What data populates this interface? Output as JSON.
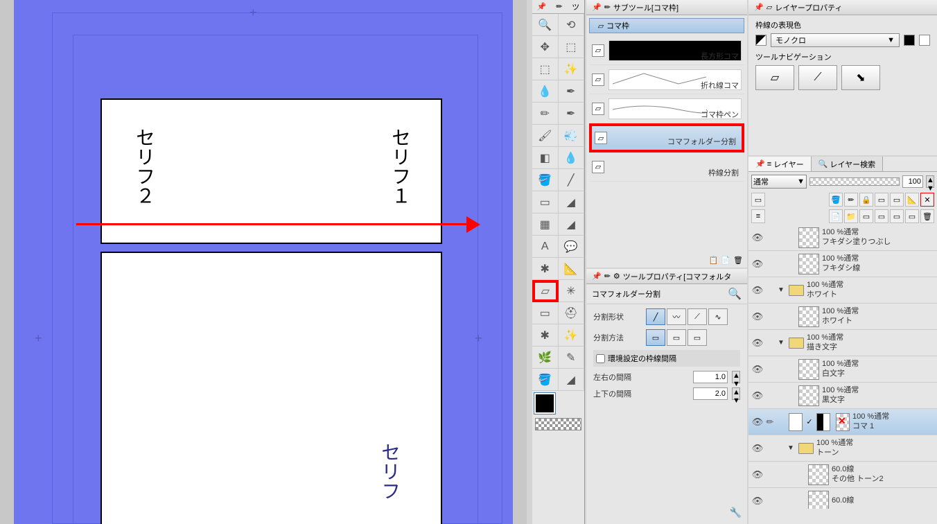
{
  "canvas": {
    "text_serif1": "セリフ１",
    "text_serif2": "セリフ２",
    "text_serif3": "セリフ"
  },
  "subtool": {
    "tab_title": "サブツール[コマ枠]",
    "header": "コマ枠",
    "items": [
      {
        "label": "長方形コマ"
      },
      {
        "label": "折れ線コマ"
      },
      {
        "label": "コマ枠ペン"
      },
      {
        "label": "コマフォルダー分割"
      },
      {
        "label": "枠線分割"
      }
    ]
  },
  "toolprop": {
    "tab_title": "ツールプロパティ[コマフォルタ",
    "title": "コマフォルダー分割",
    "shape_label": "分割形状",
    "method_label": "分割方法",
    "env_checkbox": "環境設定の枠線間隔",
    "left_right_label": "左右の間隔",
    "left_right_value": "1.0",
    "top_bottom_label": "上下の間隔",
    "top_bottom_value": "2.0"
  },
  "layerprop": {
    "tab_title": "レイヤープロパティ",
    "border_color_label": "枠線の表現色",
    "border_color_value": "モノクロ",
    "nav_label": "ツールナビゲーション"
  },
  "layers": {
    "tab1": "レイヤー",
    "tab2": "レイヤー検索",
    "blend_mode": "通常",
    "opacity": "100",
    "items": [
      {
        "line1": "100 %通常",
        "line2": "フキダシ塗りつぶし",
        "indent": 2,
        "thumb": "checker"
      },
      {
        "line1": "100 %通常",
        "line2": "フキダシ線",
        "indent": 2,
        "thumb": "checker"
      },
      {
        "line1": "100 %通常",
        "line2": "ホワイト",
        "indent": 1,
        "folder": true
      },
      {
        "line1": "100 %通常",
        "line2": "ホワイト",
        "indent": 2,
        "thumb": "checker"
      },
      {
        "line1": "100 %通常",
        "line2": "描き文字",
        "indent": 1,
        "folder": true
      },
      {
        "line1": "100 %通常",
        "line2": "白文字",
        "indent": 2,
        "thumb": "checker"
      },
      {
        "line1": "100 %通常",
        "line2": "黒文字",
        "indent": 2,
        "thumb": "checker"
      },
      {
        "line1": "100 %通常",
        "line2": "コマ 1",
        "indent": 1,
        "selected": true,
        "redx": true
      },
      {
        "line1": "100 %通常",
        "line2": "トーン",
        "indent": 2,
        "folder": true
      },
      {
        "line1": "60.0線",
        "line2": "その他 トーン2",
        "indent": 3,
        "thumb": "checker"
      },
      {
        "line1": "60.0線",
        "line2": "",
        "indent": 3,
        "thumb": "checker"
      }
    ]
  }
}
